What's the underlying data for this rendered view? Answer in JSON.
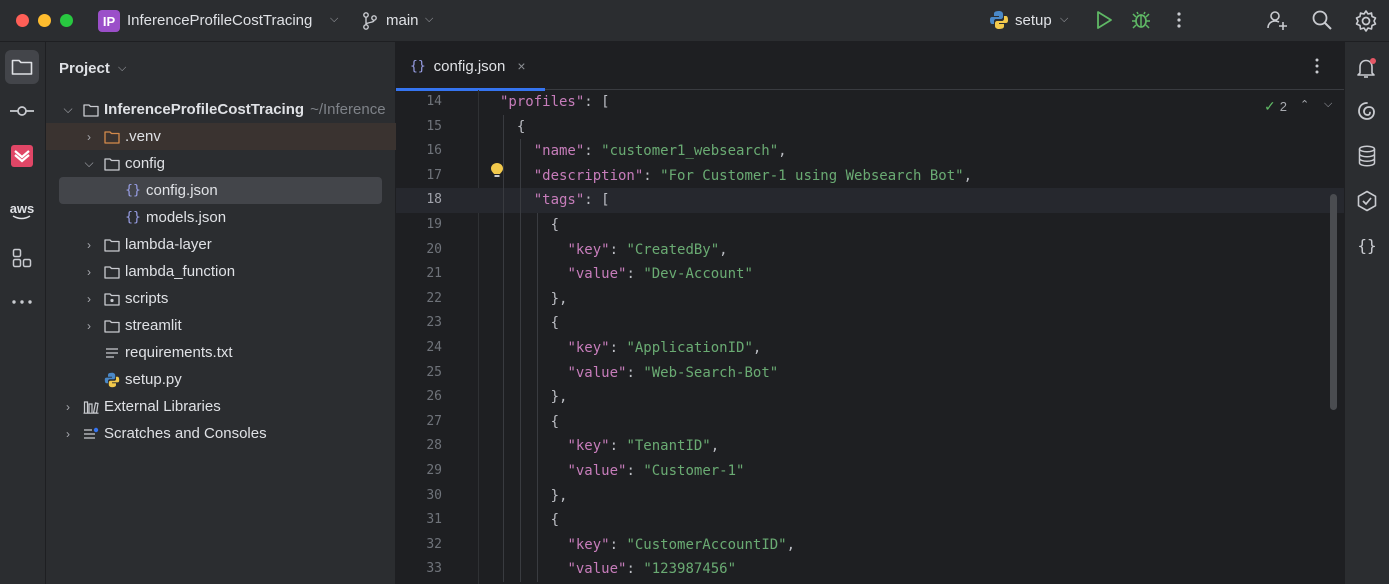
{
  "titlebar": {
    "project_badge": "IP",
    "project_name": "InferenceProfileCostTracing",
    "branch": "main",
    "run_config": "setup",
    "icons": [
      "play-icon",
      "debug-icon",
      "more-vertical-icon",
      "add-user-icon",
      "search-icon",
      "settings-icon"
    ]
  },
  "left_toolstrip": [
    "folder-icon",
    "commit-icon",
    "plugin-icon",
    "aws-icon",
    "structure-icon",
    "more-horizontal-icon"
  ],
  "aws_label": "aws",
  "project_panel": {
    "title": "Project",
    "tree": [
      {
        "label": "InferenceProfileCostTracing",
        "suffix": "~/Inference",
        "type": "folder",
        "expanded": true
      },
      {
        "label": ".venv",
        "type": "folder-excluded",
        "expanded": false
      },
      {
        "label": "config",
        "type": "folder",
        "expanded": true
      },
      {
        "label": "config.json",
        "type": "json"
      },
      {
        "label": "models.json",
        "type": "json"
      },
      {
        "label": "lambda-layer",
        "type": "folder",
        "expanded": false
      },
      {
        "label": "lambda_function",
        "type": "folder",
        "expanded": false
      },
      {
        "label": "scripts",
        "type": "folder",
        "expanded": false
      },
      {
        "label": "streamlit",
        "type": "folder",
        "expanded": false
      },
      {
        "label": "requirements.txt",
        "type": "text"
      },
      {
        "label": "setup.py",
        "type": "python"
      },
      {
        "label": "External Libraries",
        "type": "library",
        "expanded": false
      },
      {
        "label": "Scratches and Consoles",
        "type": "scratches",
        "expanded": false
      }
    ]
  },
  "editor": {
    "tab_label": "config.json",
    "tab_close": "×",
    "inspection_count": "2",
    "current_line": 18,
    "lines": [
      {
        "n": "14",
        "indent": 6,
        "parts": [
          [
            "k",
            "\"profiles\""
          ],
          [
            "p",
            ": ["
          ]
        ]
      },
      {
        "n": "15",
        "indent": 8,
        "parts": [
          [
            "p",
            "{"
          ]
        ]
      },
      {
        "n": "16",
        "indent": 10,
        "parts": [
          [
            "k",
            "\"name\""
          ],
          [
            "p",
            ": "
          ],
          [
            "s",
            "\"customer1_websearch\""
          ],
          [
            "p",
            ","
          ]
        ]
      },
      {
        "n": "17",
        "indent": 10,
        "parts": [
          [
            "k",
            "\"description\""
          ],
          [
            "p",
            ": "
          ],
          [
            "s",
            "\"For Customer-1 using Websearch Bot\""
          ],
          [
            "p",
            ","
          ]
        ]
      },
      {
        "n": "18",
        "indent": 10,
        "parts": [
          [
            "k",
            "\"tags\""
          ],
          [
            "p",
            ": ["
          ]
        ]
      },
      {
        "n": "19",
        "indent": 12,
        "parts": [
          [
            "p",
            "{"
          ]
        ]
      },
      {
        "n": "20",
        "indent": 14,
        "parts": [
          [
            "k",
            "\"key\""
          ],
          [
            "p",
            ": "
          ],
          [
            "s",
            "\"CreatedBy\""
          ],
          [
            "p",
            ","
          ]
        ]
      },
      {
        "n": "21",
        "indent": 14,
        "parts": [
          [
            "k",
            "\"value\""
          ],
          [
            "p",
            ": "
          ],
          [
            "s",
            "\"Dev-Account\""
          ]
        ]
      },
      {
        "n": "22",
        "indent": 12,
        "parts": [
          [
            "p",
            "},"
          ]
        ]
      },
      {
        "n": "23",
        "indent": 12,
        "parts": [
          [
            "p",
            "{"
          ]
        ]
      },
      {
        "n": "24",
        "indent": 14,
        "parts": [
          [
            "k",
            "\"key\""
          ],
          [
            "p",
            ": "
          ],
          [
            "s",
            "\"ApplicationID\""
          ],
          [
            "p",
            ","
          ]
        ]
      },
      {
        "n": "25",
        "indent": 14,
        "parts": [
          [
            "k",
            "\"value\""
          ],
          [
            "p",
            ": "
          ],
          [
            "s",
            "\"Web-Search-Bot\""
          ]
        ]
      },
      {
        "n": "26",
        "indent": 12,
        "parts": [
          [
            "p",
            "},"
          ]
        ]
      },
      {
        "n": "27",
        "indent": 12,
        "parts": [
          [
            "p",
            "{"
          ]
        ]
      },
      {
        "n": "28",
        "indent": 14,
        "parts": [
          [
            "k",
            "\"key\""
          ],
          [
            "p",
            ": "
          ],
          [
            "s",
            "\"TenantID\""
          ],
          [
            "p",
            ","
          ]
        ]
      },
      {
        "n": "29",
        "indent": 14,
        "parts": [
          [
            "k",
            "\"value\""
          ],
          [
            "p",
            ": "
          ],
          [
            "s",
            "\"Customer-1\""
          ]
        ]
      },
      {
        "n": "30",
        "indent": 12,
        "parts": [
          [
            "p",
            "},"
          ]
        ]
      },
      {
        "n": "31",
        "indent": 12,
        "parts": [
          [
            "p",
            "{"
          ]
        ]
      },
      {
        "n": "32",
        "indent": 14,
        "parts": [
          [
            "k",
            "\"key\""
          ],
          [
            "p",
            ": "
          ],
          [
            "s",
            "\"CustomerAccountID\""
          ],
          [
            "p",
            ","
          ]
        ]
      },
      {
        "n": "33",
        "indent": 14,
        "parts": [
          [
            "k",
            "\"value\""
          ],
          [
            "p",
            ": "
          ],
          [
            "s",
            "\"123987456\""
          ]
        ]
      }
    ]
  },
  "right_toolstrip": [
    "notifications-icon",
    "ai-assistant-icon",
    "database-icon",
    "cloud-services-icon",
    "json-icon"
  ],
  "colors": {
    "accent": "#3574f0",
    "json_key": "#c77dbb",
    "json_string": "#6aab73",
    "panel_bg": "#2b2d30",
    "editor_bg": "#1e1f22"
  }
}
